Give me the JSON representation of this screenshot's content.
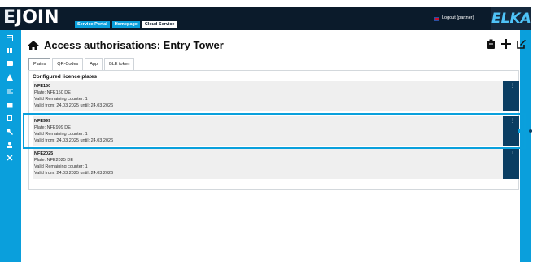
{
  "header": {
    "logo_text": "JOIN",
    "logo_prefix": "E",
    "nav": [
      {
        "label": "Service Portal",
        "active": false
      },
      {
        "label": "Homepage",
        "active": false
      },
      {
        "label": "Cloud Service",
        "active": true
      }
    ],
    "logout_label": "Logout (partner)",
    "brand": "ELKA",
    "flag_icon": "uk-flag-icon"
  },
  "sidebar": {
    "items": [
      "dashboard-icon",
      "grid-icon",
      "list-icon",
      "alert-icon",
      "inbox-icon",
      "calendar-icon",
      "device-icon",
      "key-icon",
      "user-icon",
      "users-icon"
    ]
  },
  "page": {
    "title": "Access authorisations: Entry Tower",
    "actions": [
      "clipboard-icon",
      "plus-icon",
      "edit-icon"
    ]
  },
  "tabs": [
    {
      "label": "Plates",
      "active": true
    },
    {
      "label": "QR-Codes",
      "active": false
    },
    {
      "label": "App",
      "active": false
    },
    {
      "label": "BLE token",
      "active": false
    }
  ],
  "section": {
    "title": "Configured licence plates"
  },
  "plates": [
    {
      "name": "NFE150",
      "plate": "Plate: NFE150 DE",
      "counter": "Valid Remaining counter: 1",
      "valid": "Valid from: 24.03.2025 until: 24.03.2026"
    },
    {
      "name": "NFE999",
      "plate": "Plate: NFE999 DE",
      "counter": "Valid Remaining counter: 1",
      "valid": "Valid from: 24.03.2025 until: 24.03.2026"
    },
    {
      "name": "NFE2025",
      "plate": "Plate: NFE2025 DE",
      "counter": "Valid Remaining counter: 1",
      "valid": "Valid from: 24.03.2025 until: 24.03.2026"
    }
  ],
  "menu_glyph": "⋮",
  "colors": {
    "header_bg": "#0b1b2b",
    "accent": "#0aa0dc",
    "menu_bg": "#0a3d62",
    "row_bg": "#efefef"
  }
}
